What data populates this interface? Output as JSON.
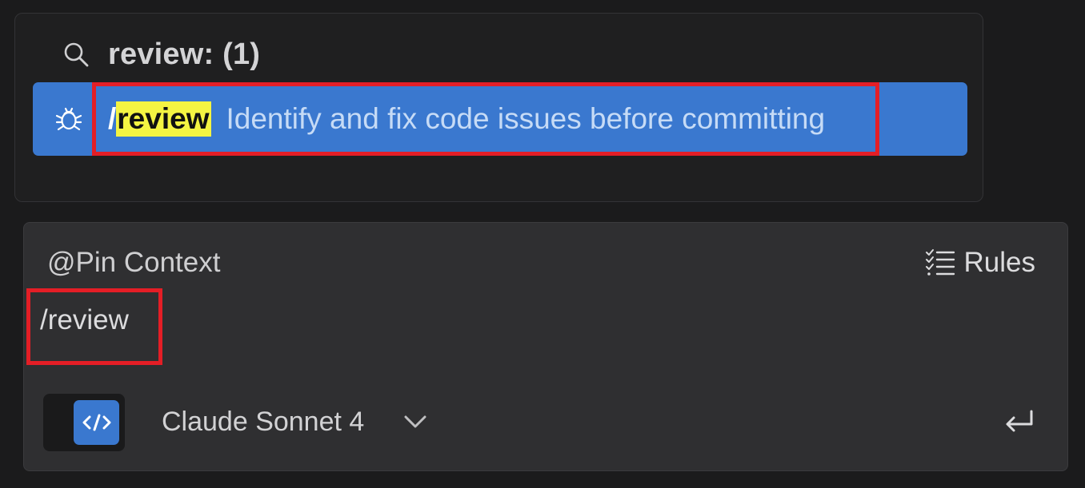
{
  "popup": {
    "search_icon": "search-icon",
    "title": "review: (1)",
    "item": {
      "icon": "bug-icon",
      "slash": "/",
      "command": "review",
      "description": "Identify and fix code issues before committing"
    }
  },
  "composer": {
    "pin_context": "@Pin Context",
    "rules_icon": "checklist-icon",
    "rules_label": "Rules",
    "input_value": "/review",
    "mode_icon": "code-icon",
    "model": "Claude Sonnet 4",
    "model_dropdown_icon": "chevron-down-icon",
    "send_icon": "enter-icon"
  },
  "colors": {
    "accent": "#3a78cf",
    "highlight": "#f4f442",
    "annotation_red": "#e41e26",
    "background": "#1b1b1c"
  }
}
